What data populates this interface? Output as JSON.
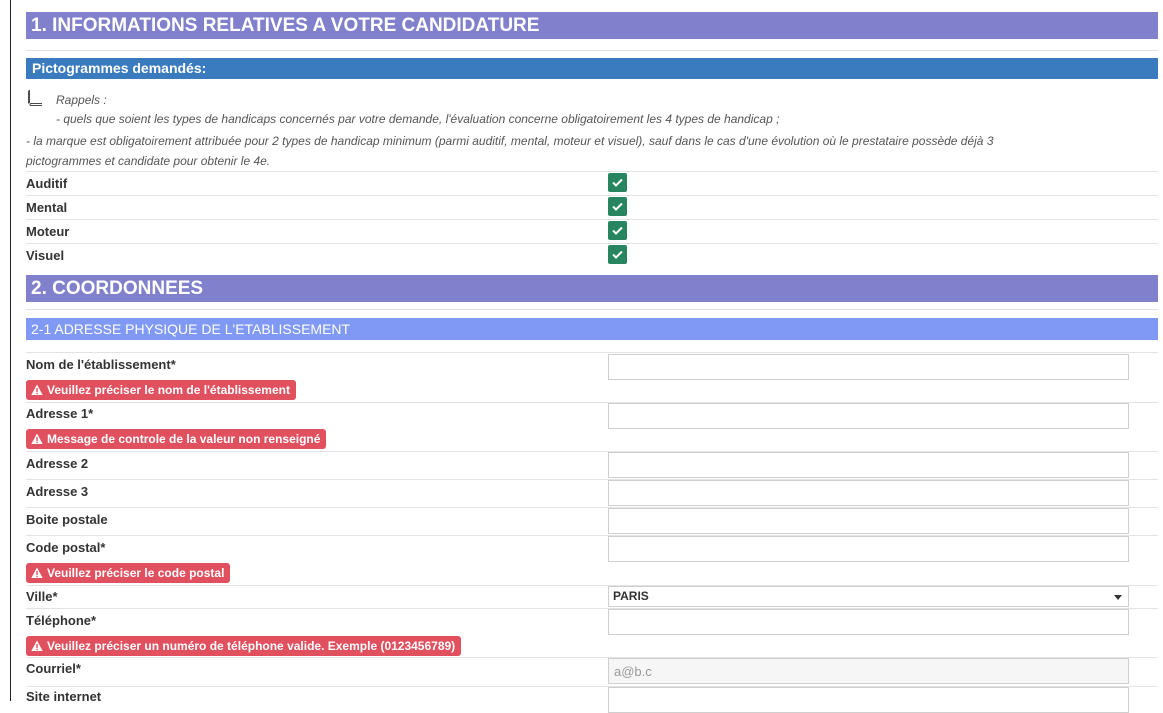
{
  "section1": {
    "title": "1. INFORMATIONS RELATIVES A VOTRE CANDIDATURE"
  },
  "pictograms": {
    "title": "Pictogrammes demandés:",
    "reminder_icon": "book-icon",
    "reminder_title": "Rappels :",
    "reminder_line1": "- quels que soient les types de handicaps concernés par votre demande, l'évaluation concerne obligatoirement les 4 types de handicap ;",
    "reminder_line2": "- la marque est obligatoirement attribuée pour 2 types de handicap minimum (parmi auditif, mental, moteur et visuel), sauf dans le cas d'une évolution où le prestataire possède déjà 3",
    "reminder_line3": "pictogrammes et candidate pour obtenir le 4e.",
    "items": [
      {
        "label": "Auditif",
        "checked": true
      },
      {
        "label": "Mental",
        "checked": true
      },
      {
        "label": "Moteur",
        "checked": true
      },
      {
        "label": "Visuel",
        "checked": true
      }
    ]
  },
  "section2": {
    "title": "2. COORDONNEES"
  },
  "address": {
    "title": "2-1 ADRESSE PHYSIQUE DE L'ETABLISSEMENT",
    "name_label": "Nom de l'établissement*",
    "name_value": "",
    "name_error": "Veuillez préciser le nom de l'établissement",
    "addr1_label": "Adresse 1*",
    "addr1_value": "",
    "addr1_error": "Message de controle de la valeur non renseigné",
    "addr2_label": "Adresse 2",
    "addr2_value": "",
    "addr3_label": "Adresse 3",
    "addr3_value": "",
    "po_box_label": "Boite postale",
    "po_box_value": "",
    "postal_label": "Code postal*",
    "postal_value": "",
    "postal_error": "Veuillez préciser le code postal",
    "city_label": "Ville*",
    "city_value": "PARIS",
    "phone_label": "Téléphone*",
    "phone_value": "",
    "phone_error": "Veuillez préciser un numéro de téléphone valide. Exemple (0123456789)",
    "email_label": "Courriel*",
    "email_value": "a@b.c",
    "website_label": "Site internet",
    "website_value": ""
  },
  "colors": {
    "section_header": "#8080cc",
    "picto_header": "#3a7bbf",
    "subsection_header": "#8099f5",
    "checkbox": "#27855f",
    "error_badge": "#e0505e"
  }
}
